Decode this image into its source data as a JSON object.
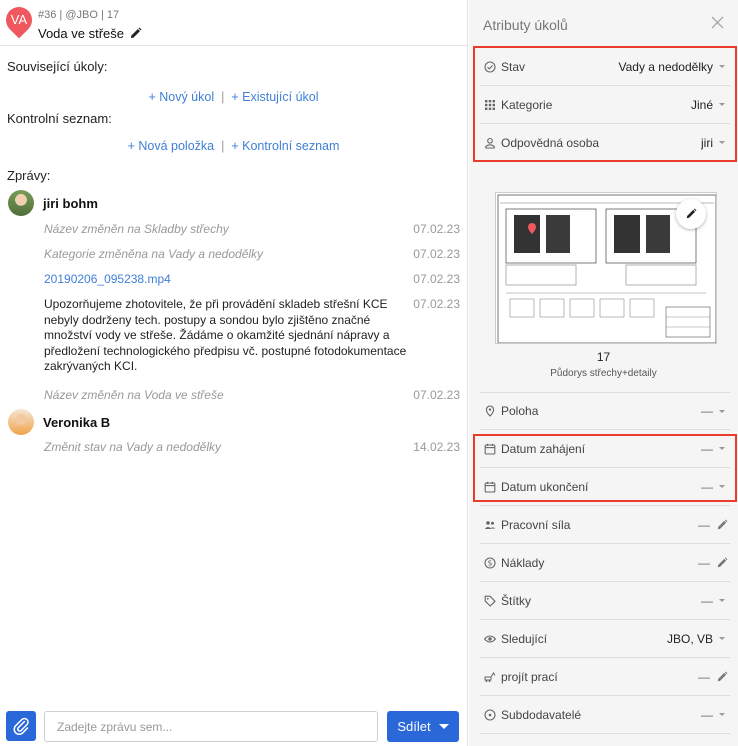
{
  "task": {
    "badge": "VA",
    "meta": "#36 | @JBO | 17",
    "title": "Voda ve střeše"
  },
  "related": {
    "label": "Související úkoly:",
    "new_task": "+ Nový úkol",
    "existing_task": "+ Existující úkol"
  },
  "checklist": {
    "label": "Kontrolní seznam:",
    "new_item": "+ Nová položka",
    "new_list": "+ Kontrolní seznam"
  },
  "messages_label": "Zprávy:",
  "messages": [
    {
      "user": "jiri bohm"
    },
    {
      "text": "Název změněn na Skladby střechy",
      "date": "07.02.23"
    },
    {
      "text": "Kategorie změněna na Vady a nedodělky",
      "date": "07.02.23"
    },
    {
      "text": "20190206_095238.mp4",
      "date": "07.02.23"
    },
    {
      "text": "Upozorňujeme zhotovitele, že při provádění skladeb střešní KCE nebyly dodrženy tech. postupy a sondou bylo zjištěno značné množství vody ve střeše. Žádáme o okamžité sjednání nápravy a předložení technologického předpisu vč. postupné fotodokumentace zakrývaných KCI.",
      "date": "07.02.23"
    },
    {
      "text": "Název změněn na Voda ve střeše",
      "date": "07.02.23"
    },
    {
      "user": "Veronika B"
    },
    {
      "text": "Změnit stav na Vady a nedodělky",
      "date": "14.02.23"
    }
  ],
  "composer": {
    "placeholder": "Zadejte zprávu sem...",
    "share_label": "Sdílet"
  },
  "panel": {
    "title": "Atributy úkolů",
    "attrs_top": [
      {
        "label": "Stav",
        "value": "Vady a nedodělky"
      },
      {
        "label": "Kategorie",
        "value": "Jiné"
      },
      {
        "label": "Odpovědná osoba",
        "value": "jiri"
      }
    ],
    "plan": {
      "number": "17",
      "caption": "Půdorys střechy+detaily"
    },
    "attrs_bottom": [
      {
        "label": "Poloha",
        "value": "—"
      },
      {
        "label": "Datum zahájení",
        "value": "—"
      },
      {
        "label": "Datum ukončení",
        "value": "—"
      },
      {
        "label": "Pracovní síla",
        "value": "—"
      },
      {
        "label": "Náklady",
        "value": "—"
      },
      {
        "label": "Štítky",
        "value": "—"
      },
      {
        "label": "Sledující",
        "value": "JBO, VB"
      },
      {
        "label": "projít prací",
        "value": "—"
      },
      {
        "label": "Subdodavatelé",
        "value": "—"
      }
    ]
  },
  "colors": {
    "accent": "#2a67d9",
    "link": "#3f7fd8",
    "highlight": "#ea3b2d",
    "badge": "#f0585f"
  }
}
